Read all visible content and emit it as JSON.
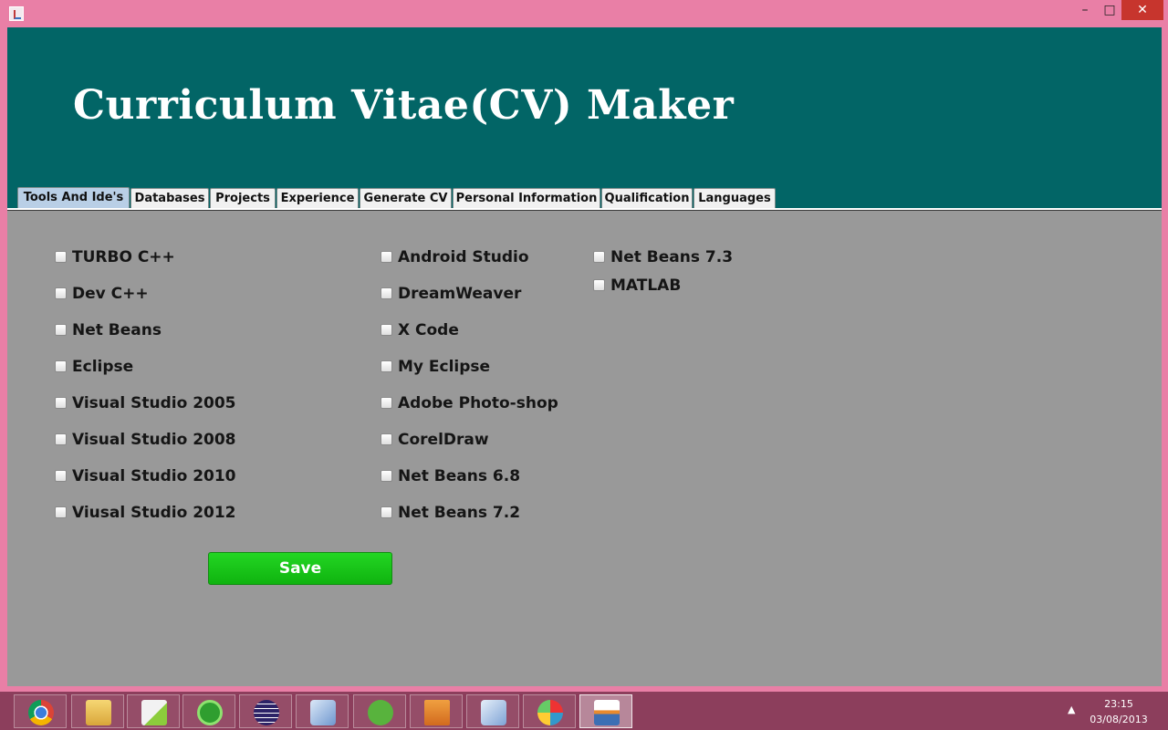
{
  "window": {
    "minimize_glyph": "–",
    "maximize_glyph": "□",
    "close_glyph": "✕"
  },
  "header": {
    "title": "Curriculum Vitae(CV) Maker"
  },
  "tabs": [
    {
      "label": "Tools And Ide's",
      "active": true
    },
    {
      "label": "Databases",
      "active": false
    },
    {
      "label": "Projects",
      "active": false
    },
    {
      "label": "Experience",
      "active": false
    },
    {
      "label": "Generate CV",
      "active": false
    },
    {
      "label": "Personal Information",
      "active": false
    },
    {
      "label": "Qualification",
      "active": false
    },
    {
      "label": "Languages",
      "active": false
    }
  ],
  "checkboxes": [
    {
      "label": "TURBO C++",
      "checked": false
    },
    {
      "label": "Dev C++",
      "checked": false
    },
    {
      "label": "Net Beans",
      "checked": false
    },
    {
      "label": "Eclipse",
      "checked": false
    },
    {
      "label": "Visual Studio 2005",
      "checked": false
    },
    {
      "label": "Visual Studio 2008",
      "checked": false
    },
    {
      "label": "Visual Studio 2010",
      "checked": false
    },
    {
      "label": "Viusal Studio 2012",
      "checked": false
    },
    {
      "label": "Android Studio",
      "checked": false
    },
    {
      "label": "DreamWeaver",
      "checked": false
    },
    {
      "label": "X Code",
      "checked": false
    },
    {
      "label": "My Eclipse",
      "checked": false
    },
    {
      "label": "Adobe Photo-shop",
      "checked": false
    },
    {
      "label": "CorelDraw",
      "checked": false
    },
    {
      "label": "Net Beans 6.8",
      "checked": false
    },
    {
      "label": "Net Beans 7.2",
      "checked": false
    },
    {
      "label": "Net Beans 7.3",
      "checked": false
    },
    {
      "label": "MATLAB",
      "checked": false
    }
  ],
  "save_label": "Save",
  "taskbar": {
    "apps": [
      {
        "name": "chrome-icon",
        "color": "#dd4b39"
      },
      {
        "name": "file-explorer-icon",
        "color": "#f3c14b"
      },
      {
        "name": "notepad-plus-plus-icon",
        "color": "#9ad14b"
      },
      {
        "name": "dreamweaver-icon",
        "color": "#4fbf3a"
      },
      {
        "name": "eclipse-icon",
        "color": "#3b3075"
      },
      {
        "name": "virtualbox-icon",
        "color": "#8fb4e3"
      },
      {
        "name": "utorrent-icon",
        "color": "#55b33a"
      },
      {
        "name": "pdf-icon",
        "color": "#e07a2a"
      },
      {
        "name": "virtualbox-icon-2",
        "color": "#9fc0ea"
      },
      {
        "name": "paint-icon",
        "color": "#e8a9c8"
      },
      {
        "name": "java-icon",
        "color": "#e88a2d"
      }
    ],
    "tray_chevron": "▲",
    "time": "23:15",
    "date": "03/08/2013"
  }
}
